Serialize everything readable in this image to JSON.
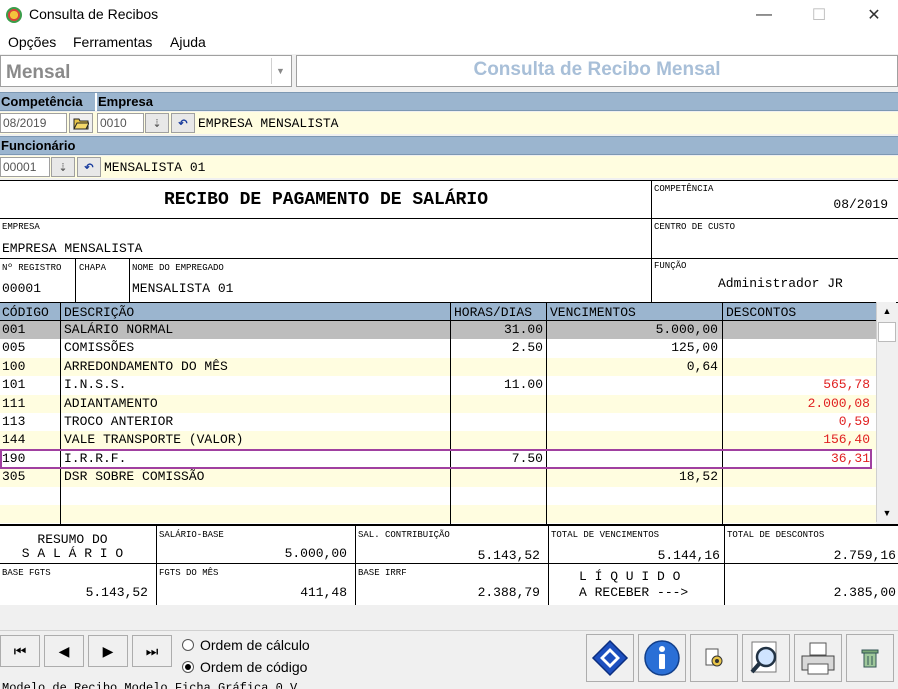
{
  "window": {
    "title": "Consulta de Recibos",
    "minimize": "—",
    "maximize": "☐",
    "close": "✕"
  },
  "menu": [
    "Opções",
    "Ferramentas",
    "Ajuda"
  ],
  "header": {
    "mode": "Mensal",
    "title": "Consulta de Recibo Mensal"
  },
  "filters": {
    "competencia_label": "Competência",
    "empresa_label": "Empresa",
    "competencia_value": "08/2019",
    "empresa_code": "0010",
    "empresa_name": "EMPRESA MENSALISTA",
    "funcionario_label": "Funcionário",
    "funcionario_code": "00001",
    "funcionario_name": "MENSALISTA 01"
  },
  "receipt": {
    "title": "RECIBO DE PAGAMENTO DE SALÁRIO",
    "competencia_label": "COMPETÊNCIA",
    "competencia": "08/2019",
    "empresa_label": "EMPRESA",
    "empresa": "EMPRESA MENSALISTA",
    "centro_custo_label": "CENTRO DE CUSTO",
    "centro_custo": "",
    "registro_label": "Nº REGISTRO",
    "registro": "00001",
    "chapa_label": "CHAPA",
    "chapa": "",
    "nome_label": "NOME DO EMPREGADO",
    "nome": "MENSALISTA 01",
    "funcao_label": "FUNÇÃO",
    "funcao": "Administrador JR"
  },
  "grid": {
    "columns": [
      "CÓDIGO",
      "DESCRIÇÃO",
      "HORAS/DIAS",
      "VENCIMENTOS",
      "DESCONTOS"
    ],
    "rows": [
      {
        "codigo": "001",
        "descricao": "SALÁRIO NORMAL",
        "horas": "31.00",
        "vencimentos": "5.000,00",
        "descontos": ""
      },
      {
        "codigo": "005",
        "descricao": "COMISSÕES",
        "horas": "2.50",
        "vencimentos": "125,00",
        "descontos": ""
      },
      {
        "codigo": "100",
        "descricao": "ARREDONDAMENTO DO MÊS",
        "horas": "",
        "vencimentos": "0,64",
        "descontos": ""
      },
      {
        "codigo": "101",
        "descricao": "I.N.S.S.",
        "horas": "11.00",
        "vencimentos": "",
        "descontos": "565,78"
      },
      {
        "codigo": "111",
        "descricao": "ADIANTAMENTO",
        "horas": "",
        "vencimentos": "",
        "descontos": "2.000,08"
      },
      {
        "codigo": "113",
        "descricao": "TROCO ANTERIOR",
        "horas": "",
        "vencimentos": "",
        "descontos": "0,59"
      },
      {
        "codigo": "144",
        "descricao": "VALE TRANSPORTE (VALOR)",
        "horas": "",
        "vencimentos": "",
        "descontos": "156,40"
      },
      {
        "codigo": "190",
        "descricao": "I.R.R.F.",
        "horas": "7.50",
        "vencimentos": "",
        "descontos": "36,31"
      },
      {
        "codigo": "305",
        "descricao": "DSR SOBRE COMISSÃO",
        "horas": "",
        "vencimentos": "18,52",
        "descontos": ""
      },
      {
        "codigo": "",
        "descricao": "",
        "horas": "",
        "vencimentos": "",
        "descontos": ""
      },
      {
        "codigo": "",
        "descricao": "",
        "horas": "",
        "vencimentos": "",
        "descontos": ""
      }
    ],
    "selected_row": 7
  },
  "summary": {
    "resumo_line1": "RESUMO DO",
    "resumo_line2": "S A L Á R I O",
    "salario_base_label": "SALÁRIO-BASE",
    "salario_base": "5.000,00",
    "sal_contribuicao_label": "SAL. CONTRIBUIÇÃO",
    "sal_contribuicao": "5.143,52",
    "total_vencimentos_label": "TOTAL DE VENCIMENTOS",
    "total_vencimentos": "5.144,16",
    "total_descontos_label": "TOTAL DE DESCONTOS",
    "total_descontos": "2.759,16",
    "base_fgts_label": "BASE FGTS",
    "base_fgts": "5.143,52",
    "fgts_mes_label": "FGTS DO MÊS",
    "fgts_mes": "411,48",
    "base_irrf_label": "BASE IRRF",
    "base_irrf": "2.388,79",
    "liquido_line1": "L Í Q U I D O",
    "liquido_line2": "A RECEBER --->",
    "liquido": "2.385,00"
  },
  "nav": {
    "order_calc": "Ordem de cálculo",
    "order_code": "Ordem de código",
    "selected_order": "order_code"
  },
  "footer_partial": "Modelo de Recibo  Modelo Ficha Gráfica  0 V"
}
